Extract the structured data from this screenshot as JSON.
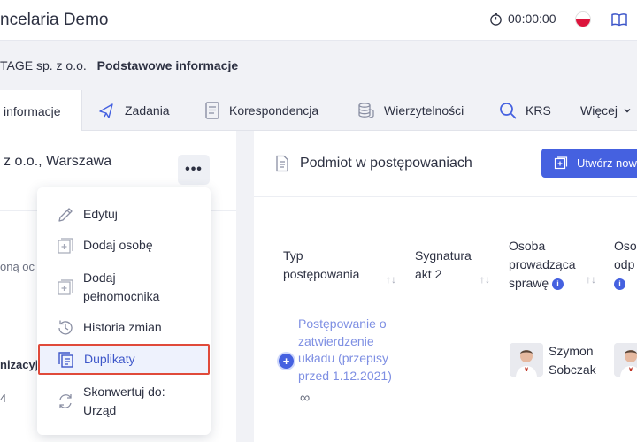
{
  "header": {
    "app_title": "ncelaria Demo",
    "timer": "00:00:00"
  },
  "breadcrumb": {
    "company": "TAGE sp. z o.o.",
    "current": "Podstawowe informacje"
  },
  "tabs": [
    {
      "label": "informacje",
      "icon": "info-icon",
      "active": true
    },
    {
      "label": "Zadania",
      "icon": "megaphone-icon"
    },
    {
      "label": "Korespondencja",
      "icon": "document-icon"
    },
    {
      "label": "Wierzytelności",
      "icon": "coins-icon"
    },
    {
      "label": "KRS",
      "icon": "search-icon"
    },
    {
      "label": "Więcej",
      "icon": "chevron-down-icon"
    }
  ],
  "left": {
    "company_name": "z o.o., Warszawa",
    "kebab": "•••",
    "text1": "oną oc",
    "text2": "nizacyj",
    "text3": "4"
  },
  "menu": {
    "items": [
      {
        "label": "Edytuj",
        "icon": "pencil-icon"
      },
      {
        "label": "Dodaj osobę",
        "icon": "add-box-icon"
      },
      {
        "label_line1": "Dodaj",
        "label_line2": "pełnomocnika",
        "icon": "add-box-icon"
      },
      {
        "label": "Historia zmian",
        "icon": "history-icon"
      },
      {
        "label": "Duplikaty",
        "icon": "duplicate-icon",
        "selected": true
      },
      {
        "label_line1": "Skonwertuj do:",
        "label_line2": "Urząd",
        "icon": "convert-icon"
      }
    ]
  },
  "panel": {
    "title": "Podmiot w postępowaniach",
    "create_button": "Utwórz now"
  },
  "table": {
    "headers": [
      {
        "line1": "Typ",
        "line2": "postępowania",
        "sort": "↑↓"
      },
      {
        "line1": "Sygnatura",
        "line2": "akt 2",
        "sort": "↑↓"
      },
      {
        "line1": "Osoba",
        "line2": "prowadząca",
        "line3": "sprawę",
        "info": "i",
        "sort": "↑↓"
      },
      {
        "line1": "Oso",
        "line2": "odp",
        "info": "i"
      }
    ],
    "rows": [
      {
        "expand": "+",
        "proc_line1": "Postępowanie o",
        "proc_line2": "zatwierdzenie",
        "proc_line3": "układu (przepisy",
        "proc_line4": "przed 1.12.2021)",
        "link_icon": "∞",
        "person_first": "Szymon",
        "person_last": "Sobczak"
      }
    ]
  },
  "colors": {
    "accent": "#4561e0",
    "selected_border": "#e04a3a",
    "link": "#7e8fe3"
  }
}
